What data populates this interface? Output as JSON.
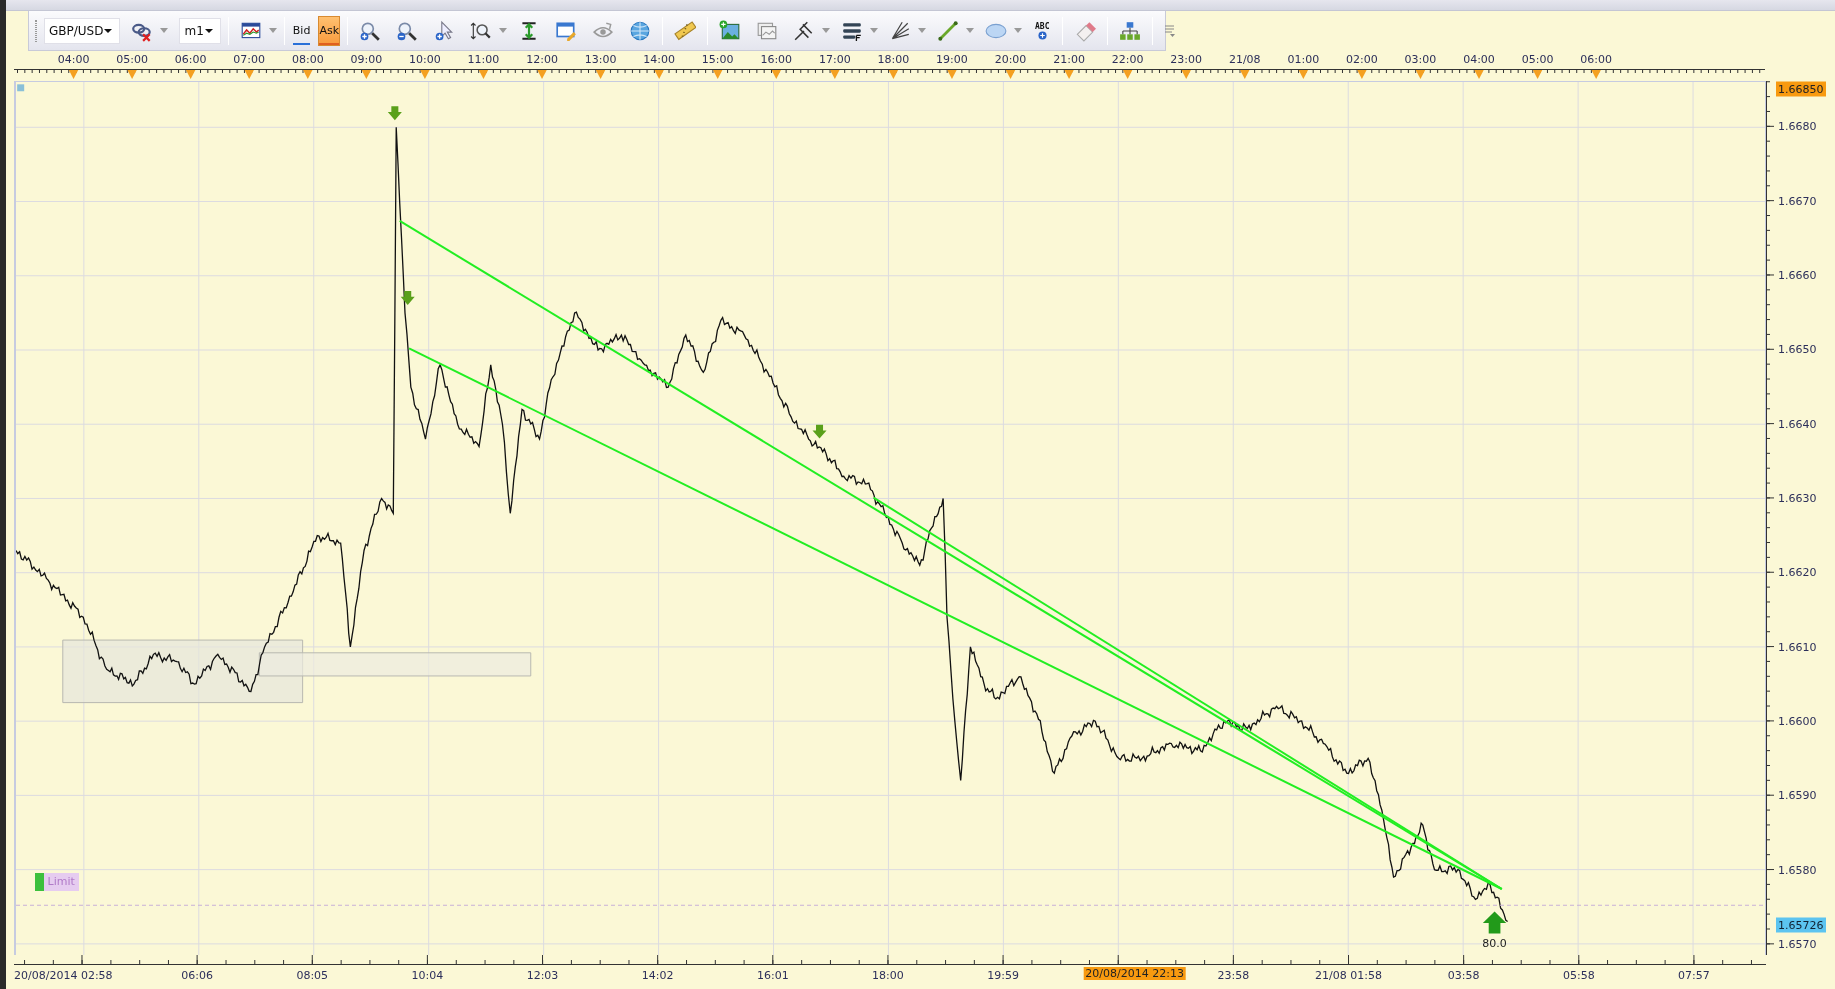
{
  "toolbar": {
    "symbol": "GBP/USD",
    "timeframe": "m1",
    "price_buttons": [
      {
        "label": "Bid",
        "selected": false
      },
      {
        "label": "Ask",
        "selected": true
      }
    ],
    "text_tool": "ABC"
  },
  "chart": {
    "chart_data": {
      "type": "line",
      "grid": true,
      "xlim": [
        "2014-08-20 02:59",
        "2014-08-21 08:53"
      ],
      "ylim": [
        1.65685,
        1.66861
      ],
      "xticks": [
        {
          "value": "2014-08-20 04:00",
          "label": "04:00"
        },
        {
          "value": "2014-08-20 05:00",
          "label": "05:00"
        },
        {
          "value": "2014-08-20 06:00",
          "label": "06:00"
        },
        {
          "value": "2014-08-20 07:00",
          "label": "07:00"
        },
        {
          "value": "2014-08-20 08:00",
          "label": "08:00"
        },
        {
          "value": "2014-08-20 09:00",
          "label": "09:00"
        },
        {
          "value": "2014-08-20 10:00",
          "label": "10:00"
        },
        {
          "value": "2014-08-20 11:00",
          "label": "11:00"
        },
        {
          "value": "2014-08-20 12:00",
          "label": "12:00"
        },
        {
          "value": "2014-08-20 13:00",
          "label": "13:00"
        },
        {
          "value": "2014-08-20 14:00",
          "label": "14:00"
        },
        {
          "value": "2014-08-20 15:00",
          "label": "15:00"
        },
        {
          "value": "2014-08-20 16:00",
          "label": "16:00"
        },
        {
          "value": "2014-08-20 17:00",
          "label": "17:00"
        },
        {
          "value": "2014-08-20 18:00",
          "label": "18:00"
        },
        {
          "value": "2014-08-20 19:00",
          "label": "19:00"
        },
        {
          "value": "2014-08-20 20:00",
          "label": "20:00"
        },
        {
          "value": "2014-08-20 21:00",
          "label": "21:00"
        },
        {
          "value": "2014-08-20 22:00",
          "label": "22:00"
        },
        {
          "value": "2014-08-20 23:00",
          "label": "23:00"
        },
        {
          "value": "2014-08-21 00:00",
          "label": "21/08"
        },
        {
          "value": "2014-08-21 01:00",
          "label": "01:00"
        },
        {
          "value": "2014-08-21 02:00",
          "label": "02:00"
        },
        {
          "value": "2014-08-21 03:00",
          "label": "03:00"
        },
        {
          "value": "2014-08-21 04:00",
          "label": "04:00"
        },
        {
          "value": "2014-08-21 05:00",
          "label": "05:00"
        },
        {
          "value": "2014-08-21 06:00",
          "label": "06:00"
        }
      ],
      "yticks": [
        {
          "value": 1.657,
          "label": "1.6570"
        },
        {
          "value": 1.658,
          "label": "1.6580"
        },
        {
          "value": 1.659,
          "label": "1.6590"
        },
        {
          "value": 1.66,
          "label": "1.6600"
        },
        {
          "value": 1.661,
          "label": "1.6610"
        },
        {
          "value": 1.662,
          "label": "1.6620"
        },
        {
          "value": 1.663,
          "label": "1.6630"
        },
        {
          "value": 1.664,
          "label": "1.6640"
        },
        {
          "value": 1.665,
          "label": "1.6650"
        },
        {
          "value": 1.666,
          "label": "1.6660"
        },
        {
          "value": 1.667,
          "label": "1.6670"
        },
        {
          "value": 1.668,
          "label": "1.6680"
        }
      ],
      "x": [
        "2014-08-20 02:59",
        "2014-08-20 03:32",
        "2014-08-20 04:08",
        "2014-08-20 04:32",
        "2014-08-20 05:00",
        "2014-08-20 05:20",
        "2014-08-20 05:44",
        "2014-08-20 06:02",
        "2014-08-20 06:26",
        "2014-08-20 07:00",
        "2014-08-20 07:14",
        "2014-08-20 07:38",
        "2014-08-20 08:08",
        "2014-08-20 08:32",
        "2014-08-20 08:42",
        "2014-08-20 08:56",
        "2014-08-20 09:14",
        "2014-08-20 09:26",
        "2014-08-20 09:29",
        "2014-08-20 09:38",
        "2014-08-20 09:44",
        "2014-08-20 09:59",
        "2014-08-20 10:14",
        "2014-08-20 10:32",
        "2014-08-20 10:54",
        "2014-08-20 11:06",
        "2014-08-20 11:18",
        "2014-08-20 11:26",
        "2014-08-20 11:38",
        "2014-08-20 11:56",
        "2014-08-20 12:08",
        "2014-08-20 12:32",
        "2014-08-20 12:56",
        "2014-08-20 13:20",
        "2014-08-20 13:44",
        "2014-08-20 14:08",
        "2014-08-20 14:26",
        "2014-08-20 14:44",
        "2014-08-20 15:02",
        "2014-08-20 15:26",
        "2014-08-20 15:50",
        "2014-08-20 16:14",
        "2014-08-20 16:32",
        "2014-08-20 16:50",
        "2014-08-20 17:08",
        "2014-08-20 17:32",
        "2014-08-20 17:50",
        "2014-08-20 18:08",
        "2014-08-20 18:26",
        "2014-08-20 18:38",
        "2014-08-20 18:50",
        "2014-08-20 18:54",
        "2014-08-20 19:02",
        "2014-08-20 19:08",
        "2014-08-20 19:18",
        "2014-08-20 19:32",
        "2014-08-20 19:44",
        "2014-08-20 20:08",
        "2014-08-20 20:26",
        "2014-08-20 20:44",
        "2014-08-20 21:02",
        "2014-08-20 21:26",
        "2014-08-20 21:50",
        "2014-08-20 22:14",
        "2014-08-20 22:44",
        "2014-08-20 23:14",
        "2014-08-20 23:38",
        "2014-08-21 00:02",
        "2014-08-21 00:32",
        "2014-08-21 00:56",
        "2014-08-21 01:20",
        "2014-08-21 01:44",
        "2014-08-21 02:06",
        "2014-08-21 02:20",
        "2014-08-21 02:32",
        "2014-08-21 02:50",
        "2014-08-21 03:02",
        "2014-08-21 03:14",
        "2014-08-21 03:38",
        "2014-08-21 03:56",
        "2014-08-21 04:11",
        "2014-08-21 04:29"
      ],
      "series": [
        {
          "color": "#111111",
          "values": [
            1.6623,
            1.6619,
            1.6614,
            1.6607,
            1.6605,
            1.6609,
            1.6608,
            1.6605,
            1.6609,
            1.6604,
            1.661,
            1.6616,
            1.6625,
            1.6624,
            1.661,
            1.6623,
            1.663,
            1.6628,
            1.668,
            1.6655,
            1.6645,
            1.6638,
            1.6648,
            1.664,
            1.6637,
            1.6648,
            1.664,
            1.6628,
            1.6642,
            1.6638,
            1.6646,
            1.6655,
            1.665,
            1.6652,
            1.6648,
            1.6645,
            1.6652,
            1.6647,
            1.6654,
            1.6652,
            1.6647,
            1.6641,
            1.6638,
            1.6636,
            1.6633,
            1.6632,
            1.6628,
            1.6624,
            1.6621,
            1.6626,
            1.663,
            1.6614,
            1.66,
            1.6592,
            1.661,
            1.6605,
            1.6603,
            1.6606,
            1.6601,
            1.6593,
            1.6598,
            1.66,
            1.6595,
            1.6595,
            1.6597,
            1.6596,
            1.66,
            1.6599,
            1.6602,
            1.66,
            1.6597,
            1.6593,
            1.6595,
            1.6588,
            1.6579,
            1.6583,
            1.6586,
            1.658,
            1.658,
            1.6576,
            1.6578,
            1.6573
          ]
        }
      ]
    },
    "markers": [
      {
        "kind": "sell"
      },
      {
        "kind": "sell"
      },
      {
        "kind": "sell"
      },
      {
        "kind": "buy",
        "label": "80.0"
      },
      {
        "kind": "limit",
        "label": "Limit"
      },
      {
        "kind": "high",
        "label": "1.66850"
      },
      {
        "kind": "current",
        "label": "1.65726"
      }
    ],
    "bottom_axis": [
      {
        "label": "20/08/2014 02:58",
        "kind": "start"
      },
      {
        "label": "06:06",
        "kind": "tick"
      },
      {
        "label": "08:05",
        "kind": "tick"
      },
      {
        "label": "10:04",
        "kind": "tick"
      },
      {
        "label": "12:03",
        "kind": "tick"
      },
      {
        "label": "14:02",
        "kind": "tick"
      },
      {
        "label": "16:01",
        "kind": "tick"
      },
      {
        "label": "18:00",
        "kind": "tick"
      },
      {
        "label": "19:59",
        "kind": "tick"
      },
      {
        "label": "20/08/2014 22:13",
        "kind": "cursor"
      },
      {
        "label": "23:58",
        "kind": "tick"
      },
      {
        "label": "21/08 01:58",
        "kind": "tick"
      },
      {
        "label": "03:58",
        "kind": "tick"
      },
      {
        "label": "05:58",
        "kind": "tick"
      },
      {
        "label": "07:57",
        "kind": "tick"
      }
    ]
  }
}
